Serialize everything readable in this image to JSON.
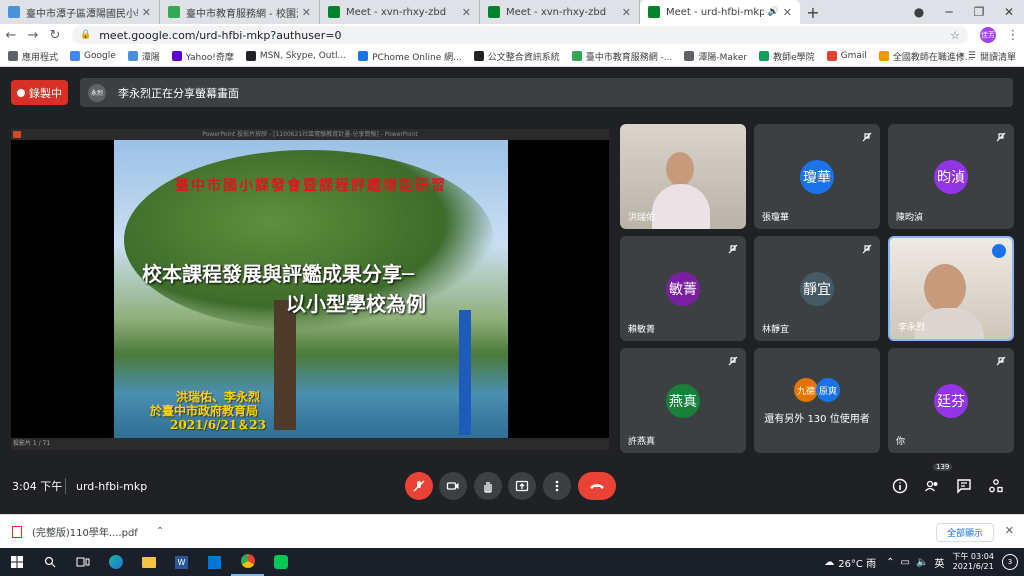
{
  "browser": {
    "tabs": [
      {
        "title": "臺中市潭子區潭陽國民小學",
        "color": "#4a90d9"
      },
      {
        "title": "臺中市教育服務網 - 校園活動報導",
        "color": "#34a853"
      },
      {
        "title": "Meet - xvn-rhxy-zbd",
        "color": "#00832d"
      },
      {
        "title": "Meet - xvn-rhxy-zbd",
        "color": "#00832d"
      },
      {
        "title": "Meet - urd-hfbi-mkp",
        "color": "#00832d"
      }
    ],
    "url": "meet.google.com/urd-hfbi-mkp?authuser=0",
    "profile_label": "佳芳",
    "bookmarks": [
      {
        "label": "應用程式",
        "color": "#5f6368"
      },
      {
        "label": "Google",
        "color": "#4285f4"
      },
      {
        "label": "潭陽",
        "color": "#4a90d9"
      },
      {
        "label": "Yahoo!奇摩",
        "color": "#6001d2"
      },
      {
        "label": "MSN, Skype, Outl...",
        "color": "#202124"
      },
      {
        "label": "PChome Online 網...",
        "color": "#1a73e8"
      },
      {
        "label": "公文整合資訊系統",
        "color": "#202124"
      },
      {
        "label": "臺中市教育服務網 -...",
        "color": "#34a853"
      },
      {
        "label": "潭陽-Maker",
        "color": "#5f6368"
      },
      {
        "label": "教師e學院",
        "color": "#0f9d58"
      },
      {
        "label": "Gmail",
        "color": "#ea4335"
      },
      {
        "label": "全國教師在職進修...",
        "color": "#f29900"
      }
    ],
    "bookmarks_more": "»",
    "reading_list": "閱讀清單"
  },
  "meet": {
    "recording_label": "錄製中",
    "share_mini": "永烈",
    "share_banner": "李永烈正在分享螢幕畫面",
    "slide": {
      "window_title": "PowerPoint 投影片放映 - [1100621社區實驗教育計畫-分享簡報] - PowerPoint",
      "subtitle": "臺中市國小課發會暨課程評鑑增能研習",
      "title_line1": "校本課程發展與評鑑成果分享─",
      "title_line2": "以小型學校為例",
      "authors": "洪瑞佑、李永烈",
      "venue": "於臺中市政府教育局",
      "date": "2021/6/21＆23",
      "status": "投影片 1 / 71"
    },
    "participants": [
      {
        "name": "洪瑞佑",
        "type": "video"
      },
      {
        "name": "張瓊華",
        "initials": "瓊華",
        "color": "#1a73e8",
        "type": "avatar"
      },
      {
        "name": "陳昀湞",
        "initials": "昀湞",
        "color": "#9334e6",
        "type": "avatar"
      },
      {
        "name": "賴敏菁",
        "initials": "敏菁",
        "color": "#7b1fa2",
        "type": "avatar"
      },
      {
        "name": "林靜宜",
        "initials": "靜宜",
        "color": "#455a64",
        "type": "avatar"
      },
      {
        "name": "李永烈",
        "type": "video"
      },
      {
        "name": "許燕真",
        "initials": "燕真",
        "color": "#188038",
        "type": "avatar"
      },
      {
        "name": "multi",
        "av1": "九德",
        "av2": "原爽",
        "label": "還有另外 130 位使用者"
      },
      {
        "name": "你",
        "initials": "廷芬",
        "color": "#9334e6",
        "type": "avatar"
      }
    ],
    "time": "3:04 下午",
    "meeting_code": "urd-hfbi-mkp",
    "participant_count": "139"
  },
  "downloads": {
    "file": "(完整版)110學年....pdf",
    "show_all": "全部顯示"
  },
  "taskbar": {
    "weather": "26°C 雨",
    "ime": "英",
    "time": "下午 03:04",
    "date": "2021/6/21",
    "notifications": "3"
  }
}
